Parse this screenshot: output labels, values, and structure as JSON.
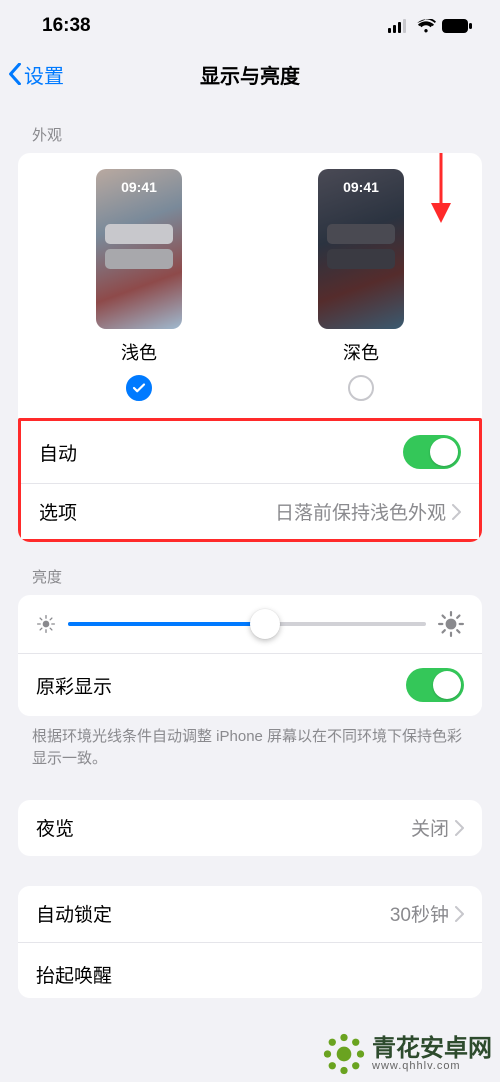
{
  "statusbar": {
    "time": "16:38"
  },
  "nav": {
    "back": "设置",
    "title": "显示与亮度"
  },
  "appearance": {
    "header": "外观",
    "preview_time": "09:41",
    "light_label": "浅色",
    "dark_label": "深色",
    "selected": "light",
    "auto_label": "自动",
    "auto_on": true,
    "options_label": "选项",
    "options_value": "日落前保持浅色外观"
  },
  "brightness": {
    "header": "亮度",
    "value_pct": 55,
    "truetone_label": "原彩显示",
    "truetone_on": true,
    "note": "根据环境光线条件自动调整 iPhone 屏幕以在不同环境下保持色彩显示一致。"
  },
  "night_shift": {
    "label": "夜览",
    "value": "关闭"
  },
  "auto_lock": {
    "label": "自动锁定",
    "value": "30秒钟"
  },
  "raise_to_wake": {
    "label": "抬起唤醒"
  },
  "watermark": {
    "brand": "青花安卓网",
    "url": "www.qhhlv.com"
  }
}
